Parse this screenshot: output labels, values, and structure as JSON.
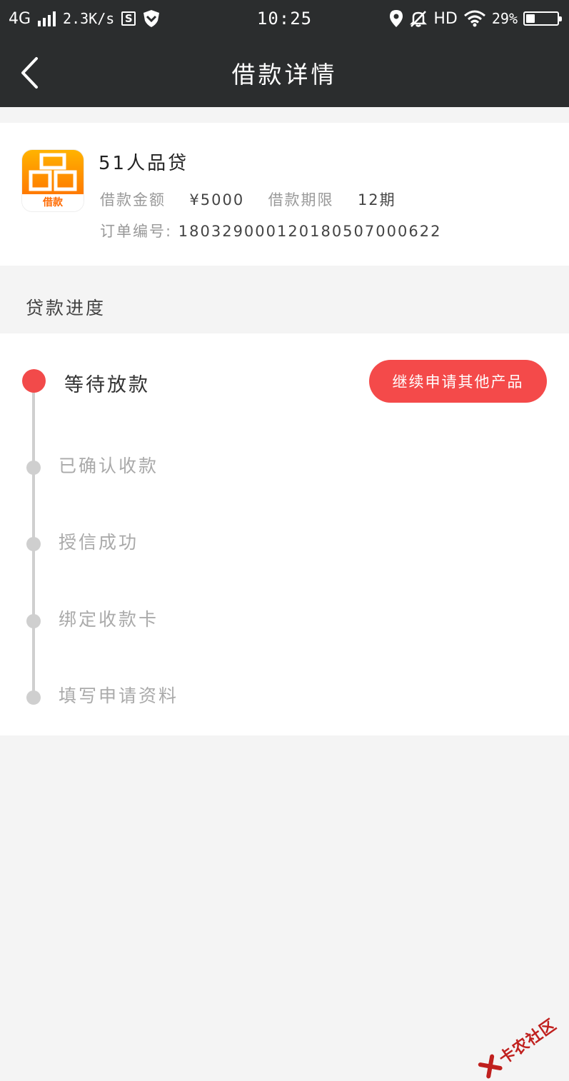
{
  "status_bar": {
    "network": "4G",
    "speed": "2.3K/s",
    "s_label": "S",
    "time": "10:25",
    "hd": "HD",
    "battery_text": "29%",
    "battery_level": 0.29
  },
  "header": {
    "title": "借款详情",
    "back_icon": "chevron-left-icon"
  },
  "product": {
    "logo_label": "借款",
    "name": "51人品贷",
    "amount_label": "借款金额",
    "amount_value": "¥5000",
    "term_label": "借款期限",
    "term_value": "12期",
    "order_label": "订单编号:",
    "order_value": "18032900012018050700062​2"
  },
  "progress": {
    "section_title": "贷款进度",
    "cta_label": "继续申请其他产品",
    "steps": [
      {
        "label": "等待放款",
        "state": "active"
      },
      {
        "label": "已确认收款",
        "state": "done"
      },
      {
        "label": "授信成功",
        "state": "done"
      },
      {
        "label": "绑定收款卡",
        "state": "done"
      },
      {
        "label": "填写申请资料",
        "state": "done"
      }
    ]
  },
  "colors": {
    "header_bg": "#2b2d2e",
    "accent_red": "#f24a4a",
    "page_bg": "#f4f4f4",
    "logo_orange": "#ff8c00"
  },
  "watermark": {
    "text": "卡农社区"
  }
}
